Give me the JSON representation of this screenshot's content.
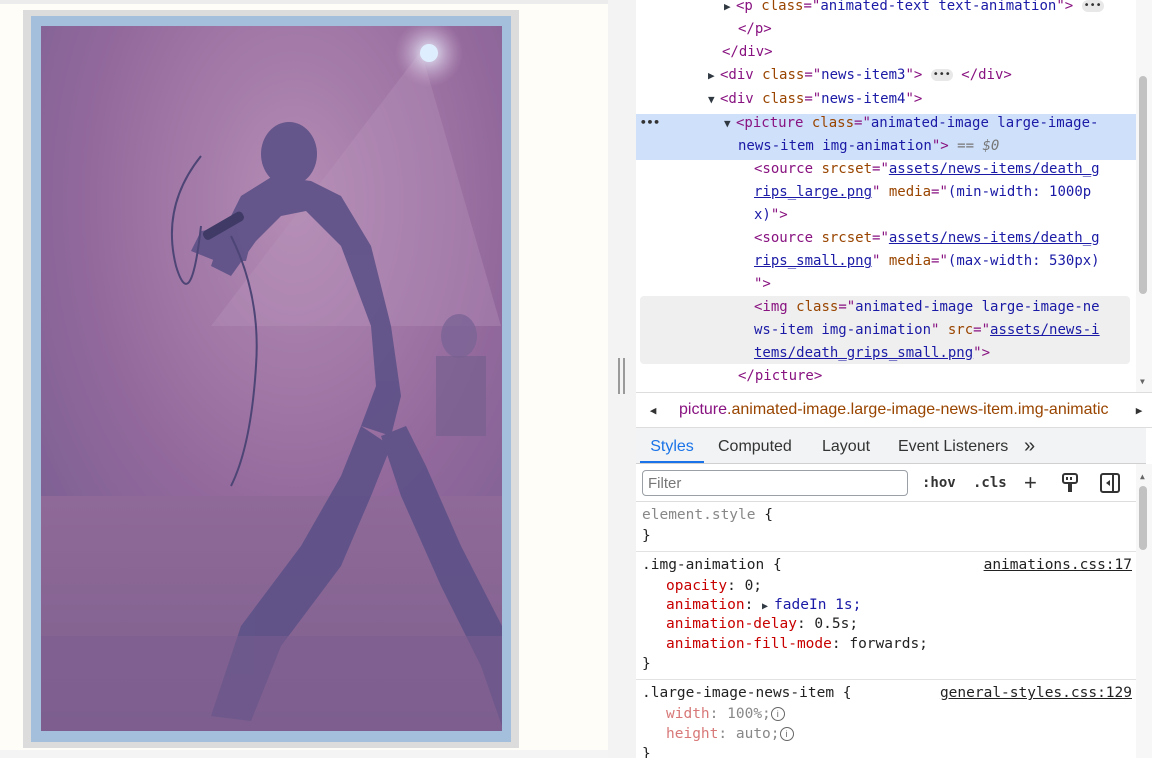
{
  "dom_tree": {
    "line1": {
      "tag_open": "<p ",
      "attr": "class",
      "eq": "=\"",
      "value": "animated-text text-animation",
      "close": "\">"
    },
    "line2": "</p>",
    "line3": "</div>",
    "line4": {
      "tag_open": "<div ",
      "attr": "class",
      "eq": "=\"",
      "value": "news-item3",
      "close": "\">",
      "end": "</div>"
    },
    "line5": {
      "tag_open": "<div ",
      "attr": "class",
      "eq": "=\"",
      "value": "news-item4",
      "close": "\">"
    },
    "selected": {
      "line_a": {
        "tag_open": "<picture ",
        "attr": "class",
        "eq": "=\"",
        "value": "animated-image large-image-"
      },
      "line_b": {
        "value": "news-item img-animation",
        "close": "\">",
        "marker": "== $0"
      }
    },
    "source1": {
      "a_open": "<source ",
      "attr1": "srcset",
      "eq": "=\"",
      "url_a": "assets/news-items/death_g",
      "url_b": "rips_large.png",
      "q": "\" ",
      "attr2": "media",
      "eq2": "=\"",
      "media_a": "(min-width: 1000p",
      "media_b": "x)",
      "close": "\">"
    },
    "source2": {
      "a_open": "<source ",
      "attr1": "srcset",
      "eq": "=\"",
      "url_a": "assets/news-items/death_g",
      "url_b": "rips_small.png",
      "q": "\" ",
      "attr2": "media",
      "eq2": "=\"",
      "media_a": "(max-width: 530px)",
      "close": "\">"
    },
    "img": {
      "a_open": "<img ",
      "attr1": "class",
      "eq": "=\"",
      "class_a": "animated-image large-image-ne",
      "class_b": "ws-item img-animation",
      "q": "\" ",
      "attr2": "src",
      "eq2": "=\"",
      "url_a": "assets/news-i",
      "url_b": "tems/death_grips_small.png",
      "close": "\">"
    },
    "close_picture": "</picture>",
    "dots": "•••"
  },
  "breadcrumb": {
    "tag": "picture",
    "classes": ".animated-image.large-image-news-item.img-animatic"
  },
  "tabs": [
    {
      "label": "Styles",
      "active": true
    },
    {
      "label": "Computed",
      "active": false
    },
    {
      "label": "Layout",
      "active": false
    },
    {
      "label": "Event Listeners",
      "active": false
    },
    {
      "label": "»",
      "active": false
    }
  ],
  "toolbar": {
    "filter_placeholder": "Filter",
    "hov": ":hov",
    "cls": ".cls",
    "plus": "+"
  },
  "styles": {
    "element_style": {
      "selector": "element.style",
      "open": " {",
      "close": "}"
    },
    "rule1": {
      "selector": ".img-animation",
      "source": "animations.css:17",
      "props": [
        {
          "name": "opacity",
          "value": "0;"
        },
        {
          "name": "animation",
          "value": "fadeIn 1s;"
        },
        {
          "name": "animation-delay",
          "value": "0.5s;"
        },
        {
          "name": "animation-fill-mode",
          "value": "forwards;"
        }
      ]
    },
    "rule2": {
      "selector": ".large-image-news-item",
      "source": "general-styles.css:129",
      "props": [
        {
          "name": "width",
          "value": "100%;"
        },
        {
          "name": "height",
          "value": "auto;"
        }
      ]
    }
  },
  "colors": {
    "selection": "#cfe0fa",
    "tag": "#881280",
    "attr": "#994500",
    "value": "#1a1aa6",
    "accent": "#1a73e8",
    "frame": "#a3bfdc"
  }
}
